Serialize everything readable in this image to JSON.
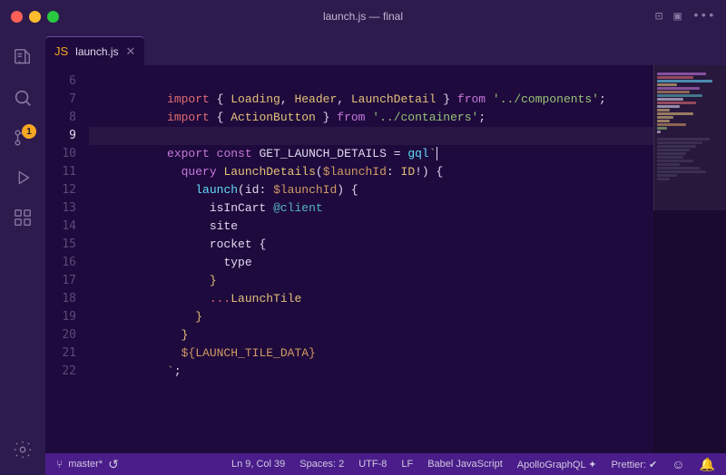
{
  "titleBar": {
    "title": "launch.js — final",
    "windowControls": [
      "close",
      "minimize",
      "maximize"
    ]
  },
  "tabs": [
    {
      "label": "launch.js",
      "active": true,
      "icon": "js-icon"
    }
  ],
  "editor": {
    "lines": [
      {
        "num": 6,
        "active": false,
        "tokens": [
          {
            "type": "imp",
            "text": "import"
          },
          {
            "type": "op",
            "text": " { "
          },
          {
            "type": "cls",
            "text": "Loading"
          },
          {
            "type": "op",
            "text": ", "
          },
          {
            "type": "cls",
            "text": "Header"
          },
          {
            "type": "op",
            "text": ", "
          },
          {
            "type": "cls",
            "text": "LaunchDetail"
          },
          {
            "type": "op",
            "text": " } "
          },
          {
            "type": "kw",
            "text": "from"
          },
          {
            "type": "str",
            "text": " '../components'"
          },
          {
            "type": "op",
            "text": ";"
          }
        ]
      },
      {
        "num": 7,
        "active": false,
        "tokens": [
          {
            "type": "imp",
            "text": "import"
          },
          {
            "type": "op",
            "text": " { "
          },
          {
            "type": "cls",
            "text": "ActionButton"
          },
          {
            "type": "op",
            "text": " } "
          },
          {
            "type": "kw",
            "text": "from"
          },
          {
            "type": "str",
            "text": " '../containers'"
          },
          {
            "type": "op",
            "text": ";"
          }
        ]
      },
      {
        "num": 8,
        "active": false,
        "tokens": []
      },
      {
        "num": 9,
        "active": true,
        "tokens": [
          {
            "type": "kw",
            "text": "export"
          },
          {
            "type": "op",
            "text": " "
          },
          {
            "type": "kw",
            "text": "const"
          },
          {
            "type": "op",
            "text": " "
          },
          {
            "type": "var",
            "text": "GET_LAUNCH_DETAILS"
          },
          {
            "type": "op",
            "text": " = "
          },
          {
            "type": "fn",
            "text": "gql"
          },
          {
            "type": "str",
            "text": "`"
          },
          {
            "type": "cursor",
            "text": ""
          }
        ]
      },
      {
        "num": 10,
        "active": false,
        "tokens": [
          {
            "type": "op",
            "text": "  "
          },
          {
            "type": "kw",
            "text": "query"
          },
          {
            "type": "op",
            "text": " "
          },
          {
            "type": "cls",
            "text": "LaunchDetails"
          },
          {
            "type": "op",
            "text": "("
          },
          {
            "type": "param",
            "text": "$launchId"
          },
          {
            "type": "op",
            "text": ": "
          },
          {
            "type": "cls",
            "text": "ID"
          },
          {
            "type": "op",
            "text": "!) {"
          }
        ]
      },
      {
        "num": 11,
        "active": false,
        "tokens": [
          {
            "type": "op",
            "text": "    "
          },
          {
            "type": "fn",
            "text": "launch"
          },
          {
            "type": "op",
            "text": "(id: "
          },
          {
            "type": "param",
            "text": "$launchId"
          },
          {
            "type": "op",
            "text": ") {"
          }
        ]
      },
      {
        "num": 12,
        "active": false,
        "tokens": [
          {
            "type": "op",
            "text": "      "
          },
          {
            "type": "var",
            "text": "isInCart"
          },
          {
            "type": "op",
            "text": " "
          },
          {
            "type": "tag",
            "text": "@client"
          }
        ]
      },
      {
        "num": 13,
        "active": false,
        "tokens": [
          {
            "type": "op",
            "text": "      "
          },
          {
            "type": "var",
            "text": "site"
          }
        ]
      },
      {
        "num": 14,
        "active": false,
        "tokens": [
          {
            "type": "op",
            "text": "      "
          },
          {
            "type": "var",
            "text": "rocket"
          },
          {
            "type": "op",
            "text": " {"
          }
        ]
      },
      {
        "num": 15,
        "active": false,
        "tokens": [
          {
            "type": "op",
            "text": "        "
          },
          {
            "type": "var",
            "text": "type"
          }
        ]
      },
      {
        "num": 16,
        "active": false,
        "tokens": [
          {
            "type": "op",
            "text": "      "
          },
          {
            "type": "bracket",
            "text": "}"
          }
        ]
      },
      {
        "num": 17,
        "active": false,
        "tokens": [
          {
            "type": "op",
            "text": "      "
          },
          {
            "type": "kw2",
            "text": "..."
          },
          {
            "type": "cls",
            "text": "LaunchTile"
          }
        ]
      },
      {
        "num": 18,
        "active": false,
        "tokens": [
          {
            "type": "op",
            "text": "    "
          },
          {
            "type": "bracket",
            "text": "}"
          }
        ]
      },
      {
        "num": 19,
        "active": false,
        "tokens": [
          {
            "type": "op",
            "text": "  "
          },
          {
            "type": "bracket",
            "text": "}"
          }
        ]
      },
      {
        "num": 20,
        "active": false,
        "tokens": [
          {
            "type": "op",
            "text": "  "
          },
          {
            "type": "param",
            "text": "${LAUNCH_TILE_DATA}"
          }
        ]
      },
      {
        "num": 21,
        "active": false,
        "tokens": [
          {
            "type": "str",
            "text": "`"
          },
          {
            "type": "op",
            "text": ";"
          }
        ]
      },
      {
        "num": 22,
        "active": false,
        "tokens": []
      }
    ]
  },
  "statusBar": {
    "branch": "master*",
    "refresh": "↺",
    "position": "Ln 9, Col 39",
    "spaces": "Spaces: 2",
    "encoding": "UTF-8",
    "lineEnding": "LF",
    "language": "Babel JavaScript",
    "graphql": "ApolloGraphQL ✦",
    "prettier": "Prettier: ✔",
    "smiley": "☺",
    "bell": "🔔"
  },
  "activityBar": {
    "icons": [
      {
        "name": "files-icon",
        "symbol": "⊞",
        "active": true
      },
      {
        "name": "search-icon",
        "symbol": "⊙",
        "active": false
      },
      {
        "name": "source-control-icon",
        "symbol": "⑃",
        "active": false,
        "badge": "1"
      },
      {
        "name": "debug-icon",
        "symbol": "▷",
        "active": false
      },
      {
        "name": "extensions-icon",
        "symbol": "⊞",
        "active": false
      }
    ],
    "bottomIcons": [
      {
        "name": "settings-icon",
        "symbol": "⚙",
        "active": false
      }
    ]
  }
}
